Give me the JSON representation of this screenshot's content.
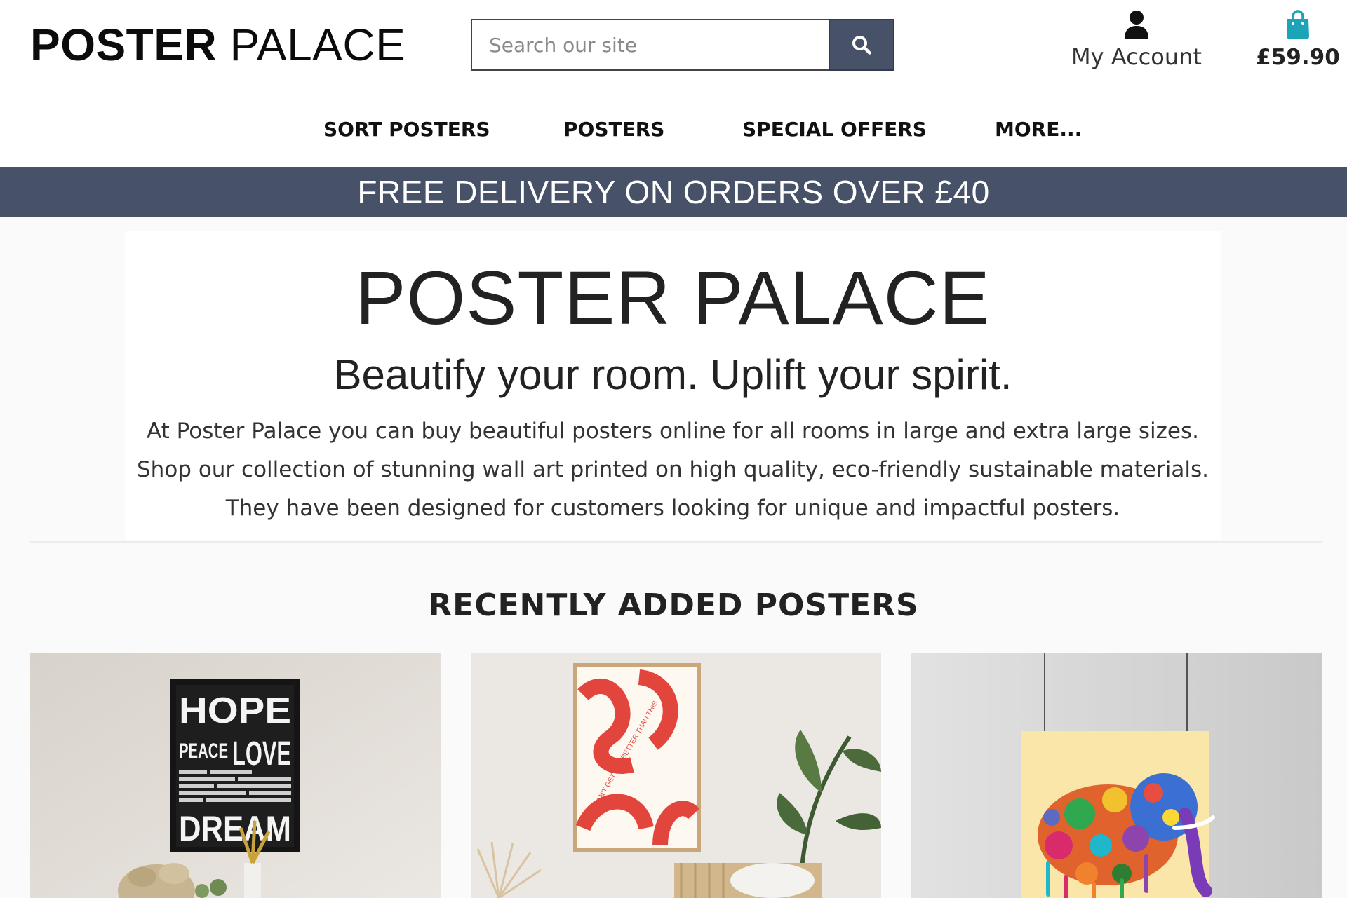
{
  "header": {
    "logo_bold": "POSTER",
    "logo_light": "PALACE",
    "search": {
      "placeholder": "Search our site",
      "value": ""
    },
    "search_icon": "magnifier-icon",
    "account": {
      "icon": "user-icon",
      "label": "My Account"
    },
    "basket": {
      "icon": "shopping-bag-icon",
      "total": "£59.90"
    },
    "nav": [
      {
        "label": "SORT POSTERS"
      },
      {
        "label": "POSTERS"
      },
      {
        "label": "SPECIAL OFFERS"
      },
      {
        "label": "MORE..."
      }
    ]
  },
  "banner": {
    "text": "FREE DELIVERY ON ORDERS OVER £40"
  },
  "hero": {
    "title": "POSTER PALACE",
    "tagline": "Beautify your room. Uplift your spirit.",
    "paragraph": [
      "At Poster Palace you can buy beautiful posters online for all rooms in large and extra large sizes.",
      "Shop our collection of stunning wall art printed on high quality, eco-friendly sustainable materials.",
      "They have been designed for customers looking for unique and impactful posters."
    ]
  },
  "recent": {
    "title": "RECENTLY ADDED POSTERS",
    "posters": [
      {
        "image": "typography-poster-image",
        "poster_text": [
          "HOPE",
          "PEACE",
          "LOVE",
          "DREAM"
        ]
      },
      {
        "image": "red-waves-poster-image",
        "poster_text": "IT CAN'T GET ANY BETTER THAN THIS"
      },
      {
        "image": "colorful-elephant-poster-image"
      }
    ]
  },
  "colors": {
    "accent": "#475269",
    "basket_icon": "#1ba3b8",
    "text": "#222222",
    "background": "#fafafa"
  }
}
